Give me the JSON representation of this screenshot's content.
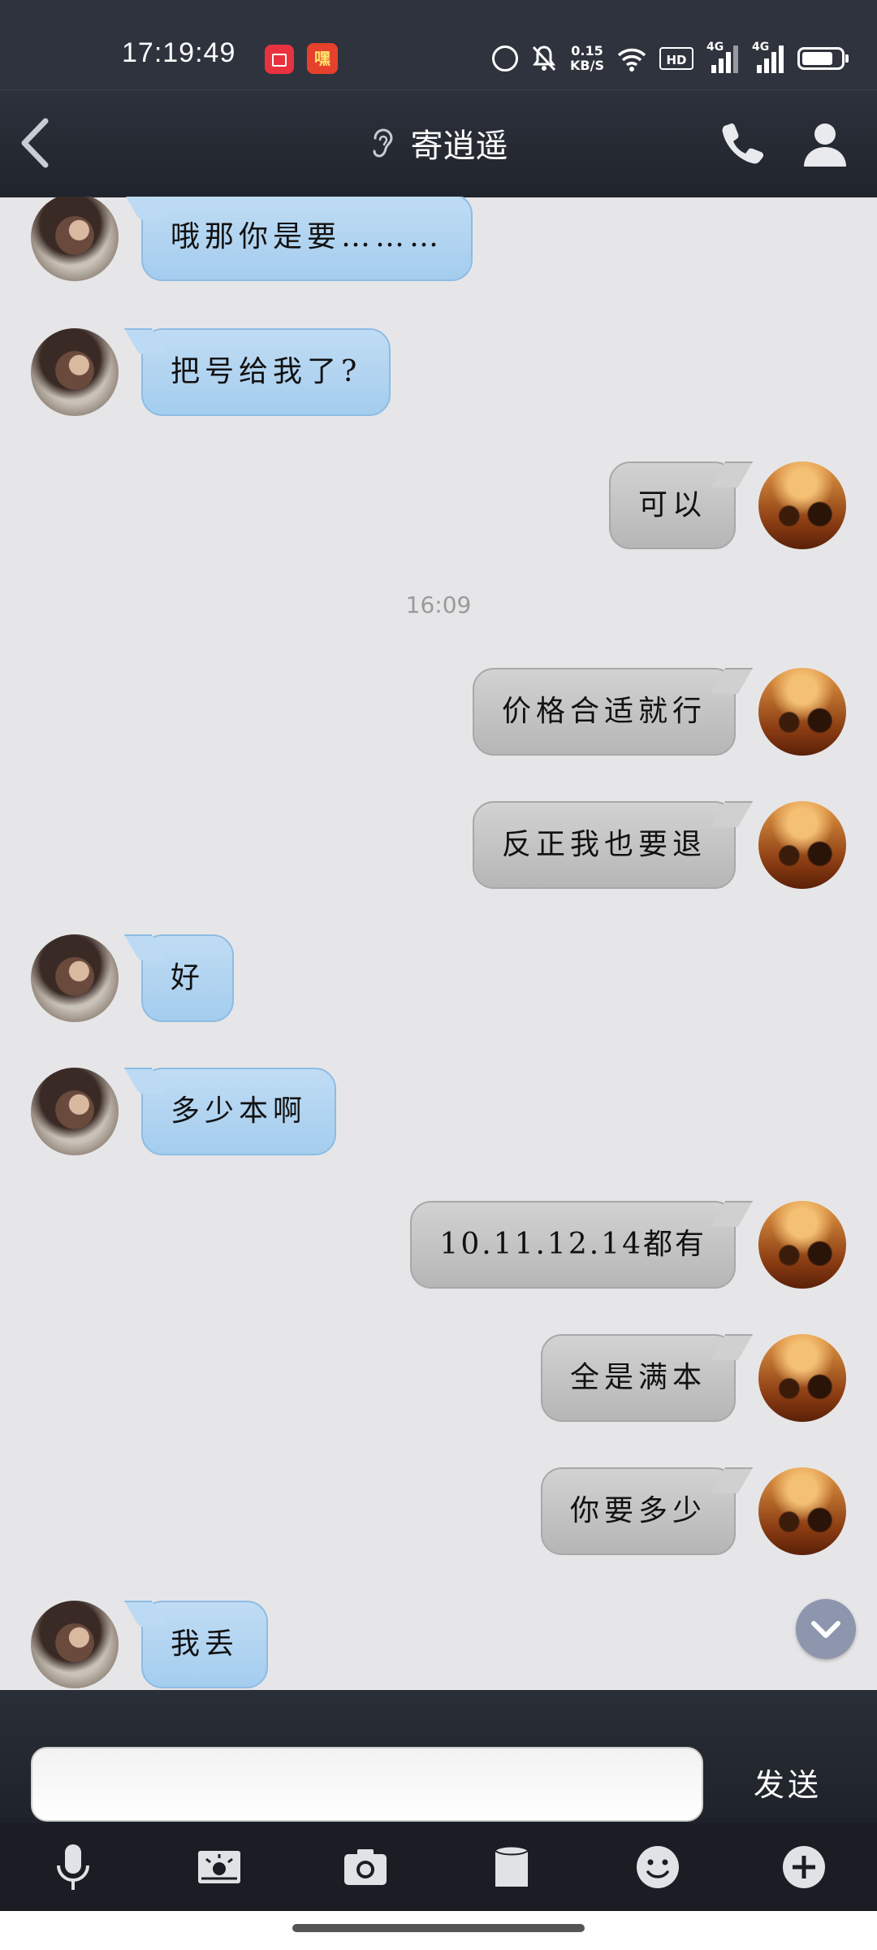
{
  "status_bar": {
    "time": "17:19:49",
    "net_speed_value": "0.15",
    "net_speed_unit": "KB/S",
    "hd_label": "HD",
    "signal1_label": "4G",
    "signal2_label": "4G",
    "app_icon2_label": "嘿"
  },
  "header": {
    "title": "寄逍遥"
  },
  "messages": [
    {
      "sender": "friend",
      "text": "哦那你是要………"
    },
    {
      "sender": "friend",
      "text": "把号给我了?"
    },
    {
      "sender": "me",
      "text": "可以"
    },
    {
      "timestamp": "16:09"
    },
    {
      "sender": "me",
      "text": "价格合适就行"
    },
    {
      "sender": "me",
      "text": "反正我也要退"
    },
    {
      "sender": "friend",
      "text": "好"
    },
    {
      "sender": "friend",
      "text": "多少本啊"
    },
    {
      "sender": "me",
      "text": "10.11.12.14都有"
    },
    {
      "sender": "me",
      "text": "全是满本"
    },
    {
      "sender": "me",
      "text": "你要多少"
    },
    {
      "sender": "friend",
      "text": "我丢"
    }
  ],
  "composer": {
    "input_value": "",
    "send_label": "发送"
  },
  "toolbar": {
    "icons": [
      "microphone-icon",
      "image-icon",
      "camera-icon",
      "file-icon",
      "emoji-icon",
      "plus-icon"
    ]
  },
  "colors": {
    "friend_bubble": "#b4d6f2",
    "my_bubble": "#c4c4c4",
    "chat_background": "#e6e6e8",
    "header_background": "#2c313b"
  }
}
